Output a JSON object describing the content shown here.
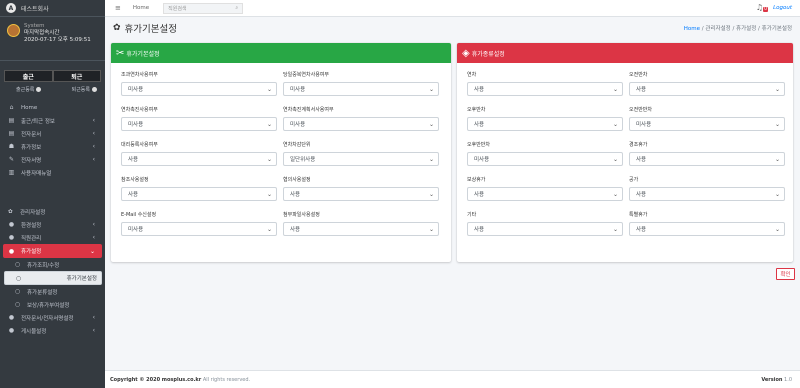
{
  "brand": {
    "name": "테스트회사"
  },
  "user": {
    "role": "System",
    "last_login_label": "마지막접속시간",
    "last_login": "2020-07-17 오후 5:09:51"
  },
  "attendance": {
    "in_label": "출근",
    "out_label": "퇴근",
    "in_reg": "출근등록",
    "out_reg": "퇴근등록"
  },
  "sidebar": {
    "items": [
      {
        "label": "Home"
      },
      {
        "label": "출근/퇴근 정보"
      },
      {
        "label": "전자문서"
      },
      {
        "label": "휴가정보"
      },
      {
        "label": "전자서명"
      },
      {
        "label": "사용자매뉴얼"
      }
    ],
    "admin_header": "관리자설정",
    "admin_items": [
      {
        "label": "환경설정"
      },
      {
        "label": "직원관리"
      },
      {
        "label": "휴가설정"
      }
    ],
    "sub_items": [
      {
        "label": "휴가조회/수정"
      },
      {
        "label": "휴가기본설정"
      },
      {
        "label": "휴가분류설정"
      },
      {
        "label": "보상/휴가부여설정"
      }
    ],
    "more_items": [
      {
        "label": "전자문서/전자서명설정"
      },
      {
        "label": "게시물설정"
      }
    ]
  },
  "topbar": {
    "home": "Home",
    "search_placeholder": "직원검색",
    "notif_count": "0",
    "logout": "Logout"
  },
  "page": {
    "title": "휴가기본설정",
    "breadcrumb_home": "Home",
    "breadcrumb_rest": "/ 관리자설정 / 휴가설정 / 휴가기본설정"
  },
  "left_card": {
    "title": "휴가기본설정",
    "fields": [
      {
        "label": "조과연차사용여부",
        "value": "미사용"
      },
      {
        "label": "당일중복연차사용여부",
        "value": "미사용"
      },
      {
        "label": "연차촉진사용여부",
        "value": "미사용"
      },
      {
        "label": "연차촉진계획서사용여부",
        "value": "미사용"
      },
      {
        "label": "대리등록사용여부",
        "value": "사용"
      },
      {
        "label": "연차차감단위",
        "value": "일단위사용"
      },
      {
        "label": "참조사용설정",
        "value": "사용"
      },
      {
        "label": "협의사용설정",
        "value": "사용"
      },
      {
        "label": "E-Mail 수신설정",
        "value": "미사용"
      },
      {
        "label": "첨부파일사용설정",
        "value": "사용"
      }
    ]
  },
  "right_card": {
    "title": "휴가종류설정",
    "fields": [
      {
        "label": "연차",
        "value": "사용"
      },
      {
        "label": "오전반차",
        "value": "사용"
      },
      {
        "label": "오후반차",
        "value": "사용"
      },
      {
        "label": "오전반반차",
        "value": "미사용"
      },
      {
        "label": "오후반반차",
        "value": "미사용"
      },
      {
        "label": "경조휴가",
        "value": "사용"
      },
      {
        "label": "보상휴가",
        "value": "사용"
      },
      {
        "label": "공가",
        "value": "사용"
      },
      {
        "label": "기타",
        "value": "사용"
      },
      {
        "label": "특별휴가",
        "value": "사용"
      }
    ]
  },
  "confirm_label": "확인",
  "footer": {
    "copyright": "Copyright © 2020 mosplus.co.kr",
    "rights": " All rights reserved.",
    "version_label": "Version",
    "version": "1.0"
  },
  "colors": {
    "green": "#28a745",
    "red": "#dc3545",
    "sidebar": "#343a40",
    "link": "#007bff"
  }
}
